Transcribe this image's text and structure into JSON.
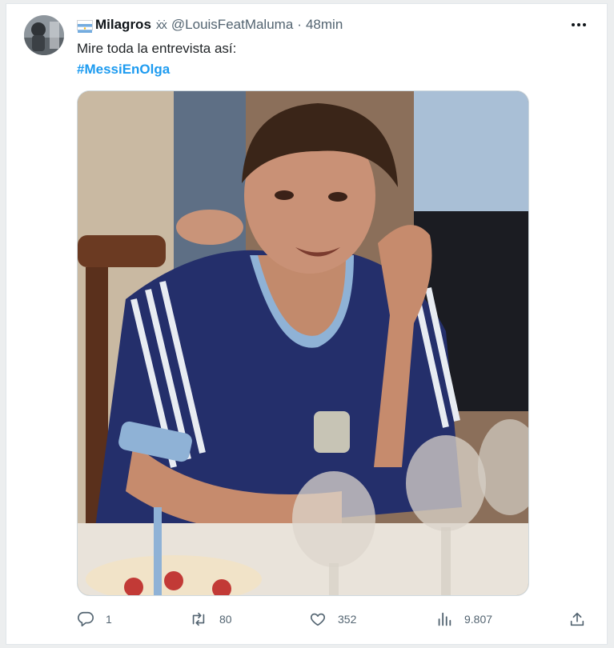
{
  "tweet": {
    "display_name": "Milagros",
    "name_suffix": "ẋẋ",
    "handle": "@LouisFeatMaluma",
    "separator": "·",
    "time": "48min",
    "text": "Mire toda la entrevista así:",
    "hashtag": "#MessiEnOlga"
  },
  "actions": {
    "replies": "1",
    "retweets": "80",
    "likes": "352",
    "views": "9.807"
  },
  "icons": {
    "more": "more-horizontal-icon",
    "reply": "reply-icon",
    "retweet": "retweet-icon",
    "like": "heart-icon",
    "views": "analytics-icon",
    "share": "share-icon"
  },
  "colors": {
    "accent": "#1d9bf0",
    "secondary_text": "#536471",
    "flag_blue": "#74acdf"
  }
}
